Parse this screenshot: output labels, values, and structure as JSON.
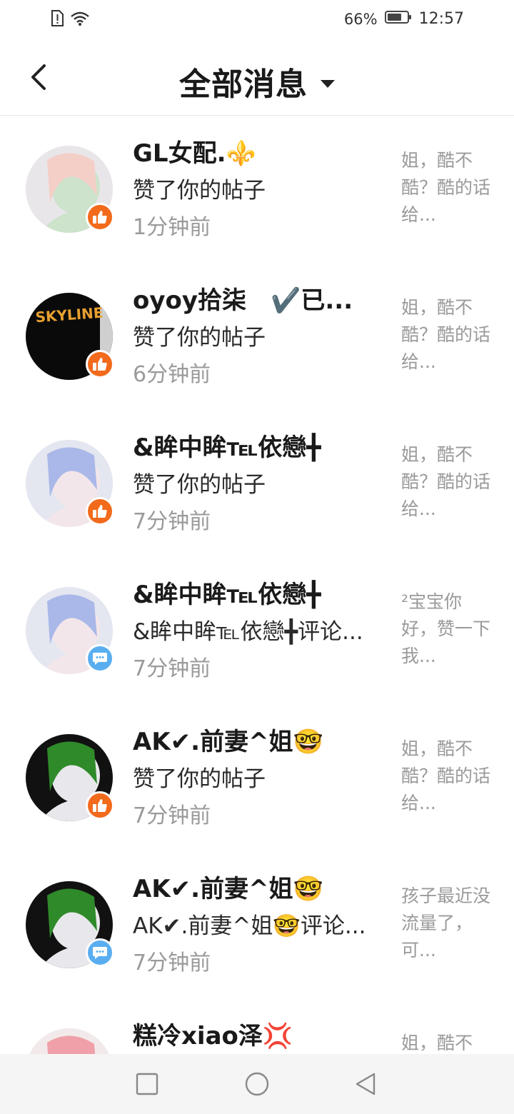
{
  "status_bar": {
    "battery": "66%",
    "time": "12:57"
  },
  "header": {
    "title": "全部消息"
  },
  "messages": [
    {
      "name": "GL女配.⚜️",
      "action": "赞了你的帖子",
      "time": "1分钟前",
      "preview": "姐，酷不酷？酷的话给...",
      "badge": "like-icon",
      "avatar_colors": [
        "#e9e6ea",
        "#f4cfc7",
        "#cde3cc"
      ]
    },
    {
      "name": "oyoy拾柒　✔️已...",
      "action": "赞了你的帖子",
      "time": "6分钟前",
      "preview": "姐，酷不酷？酷的话给...",
      "badge": "like-icon",
      "avatar_colors": [
        "#0a0a0a",
        "#e8a030",
        "#cfcfcf"
      ],
      "avatar_text": "SKYLINE"
    },
    {
      "name": "&眸中眸℡依戀╋",
      "action": "赞了你的帖子",
      "time": "7分钟前",
      "preview": "姐，酷不酷？酷的话给...",
      "badge": "like-icon",
      "avatar_colors": [
        "#e4e6f0",
        "#a9b8e8",
        "#f3e6ea"
      ]
    },
    {
      "name": "&眸中眸℡依戀╋",
      "action": "&眸中眸℡依戀╋评论...",
      "time": "7分钟前",
      "preview": "²宝宝你好，赞一下我...",
      "badge": "comment-icon",
      "avatar_colors": [
        "#e4e6f0",
        "#a9b8e8",
        "#f3e6ea"
      ]
    },
    {
      "name": "AK✔.前妻^姐🤓",
      "action": "赞了你的帖子",
      "time": "7分钟前",
      "preview": "姐，酷不酷？酷的话给...",
      "badge": "like-icon",
      "avatar_colors": [
        "#111111",
        "#2f8a2a",
        "#e8e8ec"
      ]
    },
    {
      "name": "AK✔.前妻^姐🤓",
      "action": "AK✔.前妻^姐🤓评论...",
      "time": "7分钟前",
      "preview": "孩子最近没流量了，可...",
      "badge": "comment-icon",
      "avatar_colors": [
        "#111111",
        "#2f8a2a",
        "#e8e8ec"
      ]
    },
    {
      "name": "糕冷xiao泽💢",
      "action": "",
      "time": "",
      "preview": "姐，酷不",
      "badge": "like-icon",
      "avatar_colors": [
        "#f2eaea",
        "#f0a0a8",
        "#e6e0e0"
      ]
    }
  ],
  "nav": {
    "icons": [
      "square-recents-icon",
      "circle-home-icon",
      "triangle-back-icon"
    ]
  }
}
